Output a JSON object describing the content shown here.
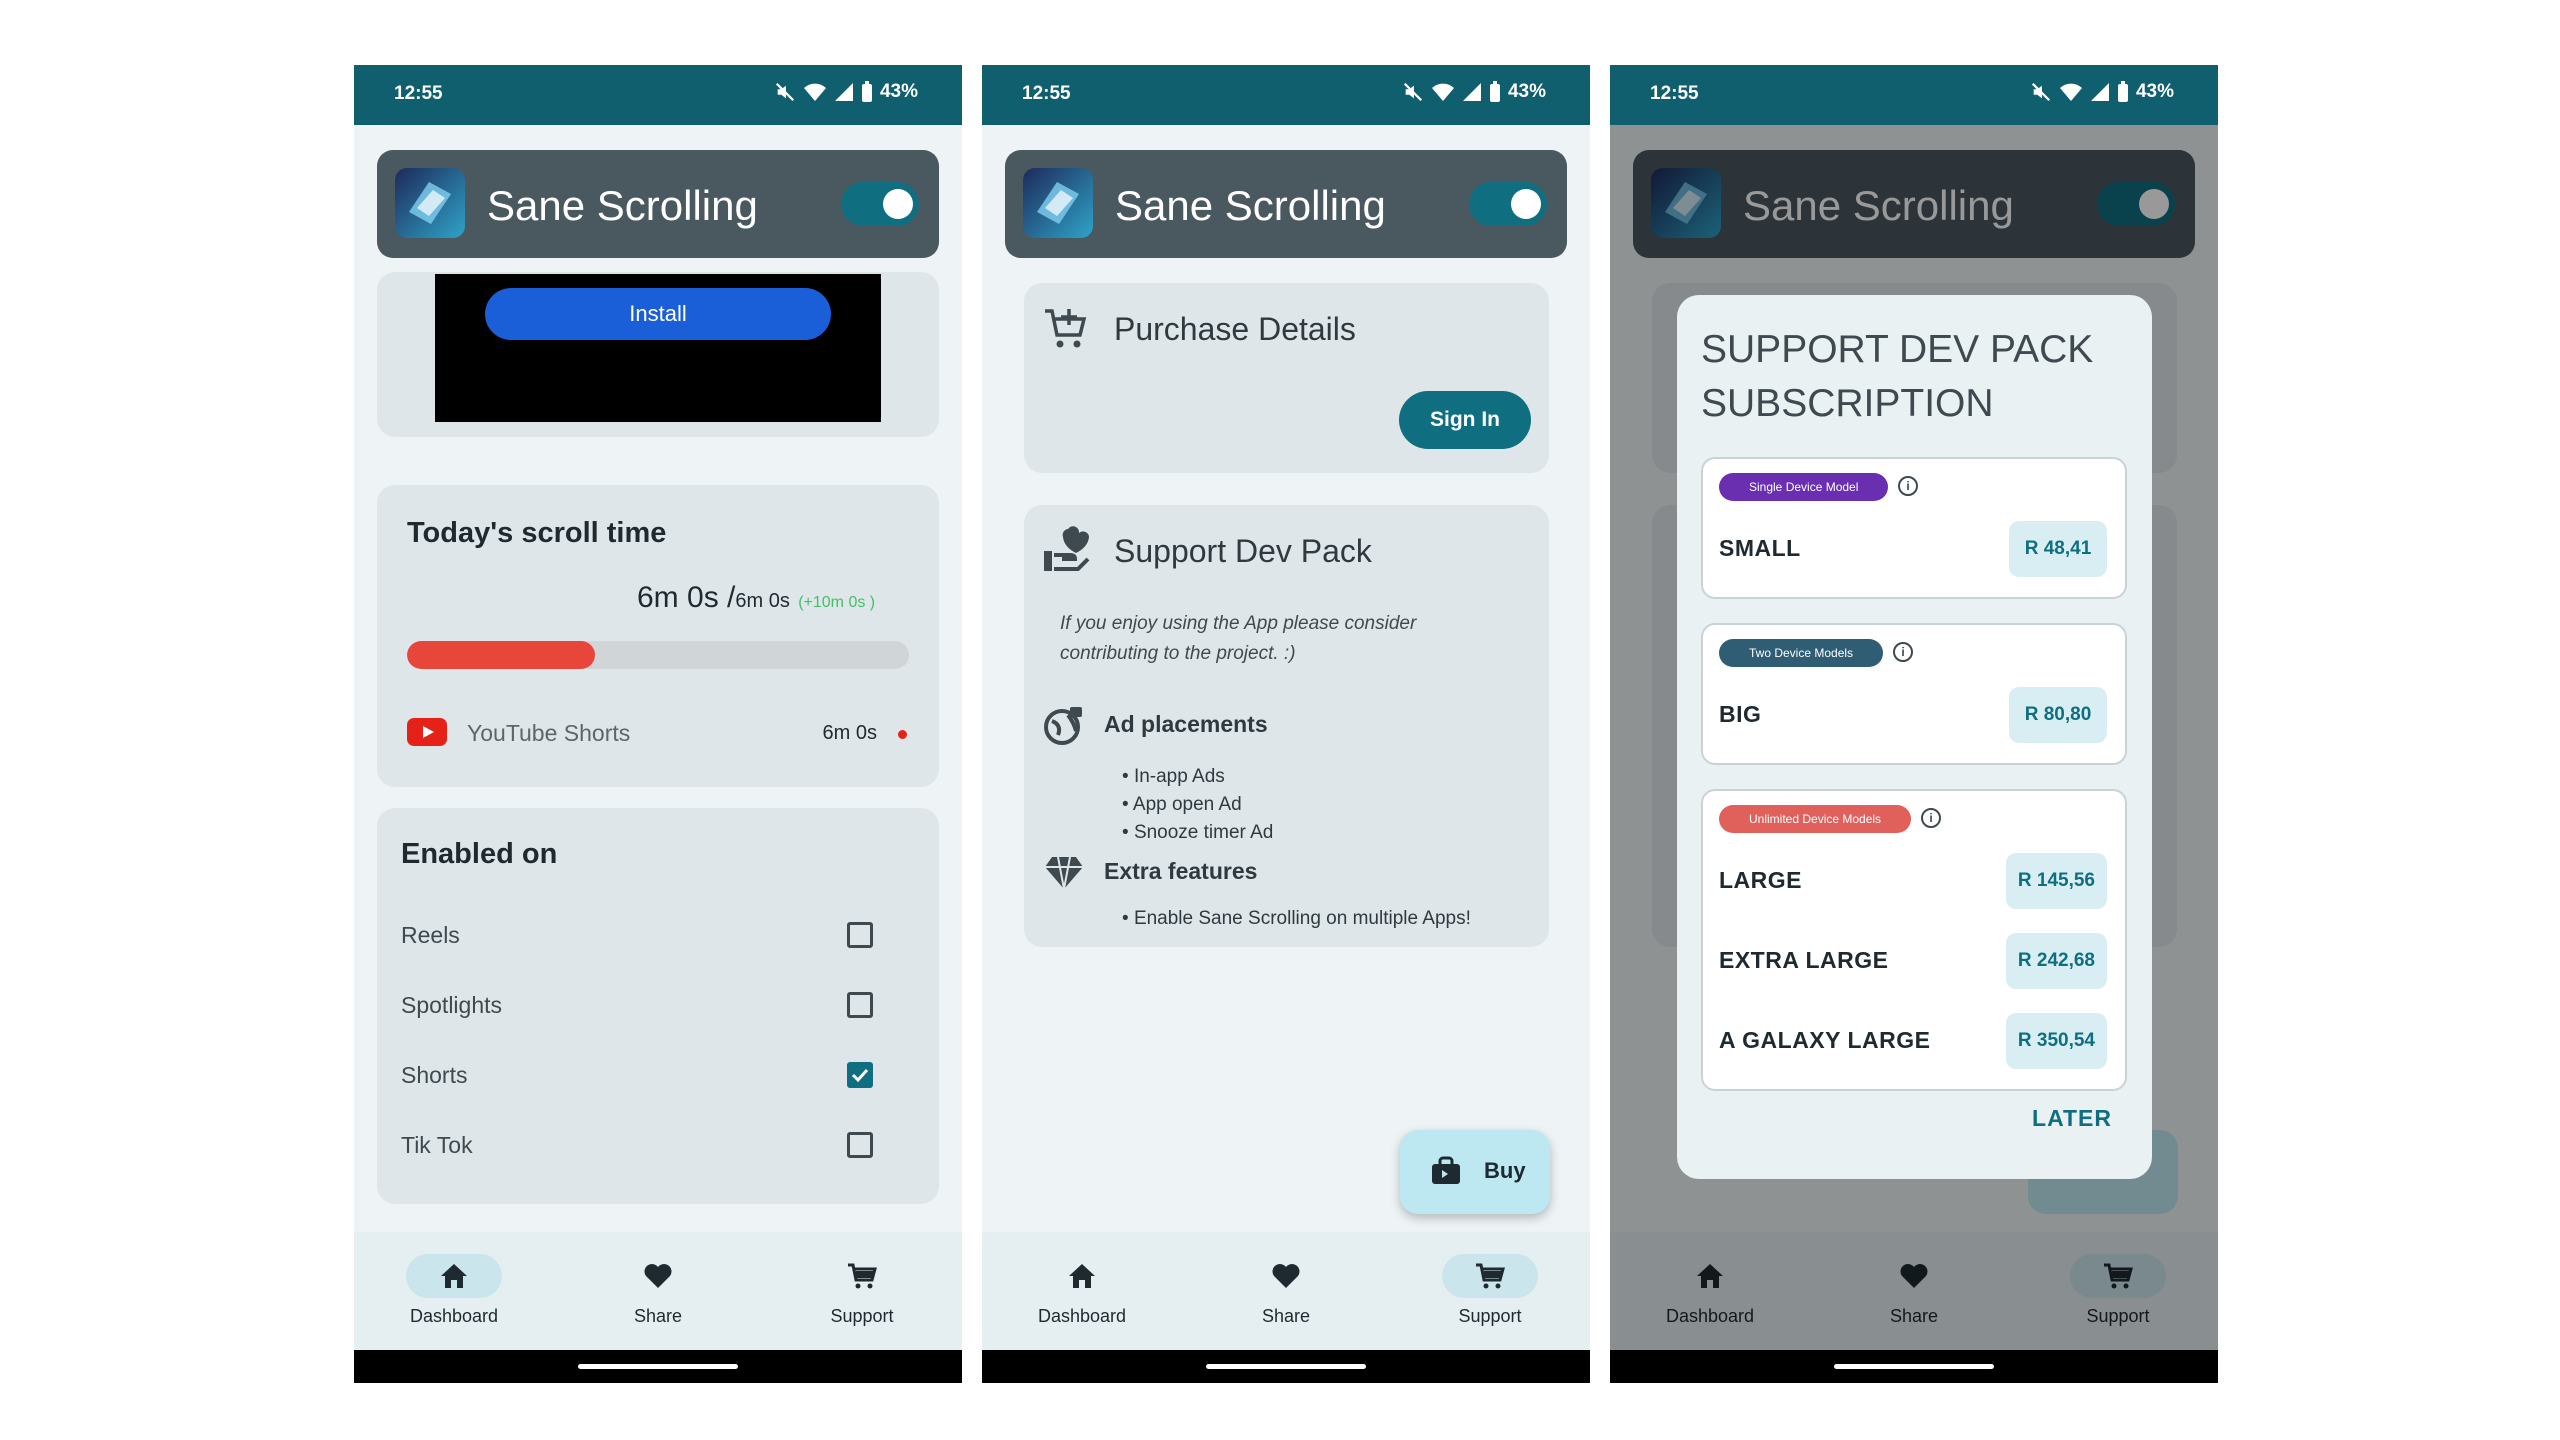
{
  "status_bar": {
    "time": "12:55",
    "battery": "43%"
  },
  "app": {
    "title": "Sane Scrolling"
  },
  "nav": {
    "dashboard": "Dashboard",
    "share": "Share",
    "support": "Support"
  },
  "screen1": {
    "ad": {
      "install_label": "Install"
    },
    "scroll_time": {
      "title": "Today's scroll time",
      "time_main": "6m 0s",
      "separator": "/",
      "limit": "6m 0s",
      "bonus": "(+10m 0s )",
      "progress_fraction": 0.375,
      "app_name": "YouTube Shorts",
      "app_time": "6m 0s"
    },
    "enabled_on": {
      "title": "Enabled on",
      "items": [
        {
          "label": "Reels",
          "checked": false
        },
        {
          "label": "Spotlights",
          "checked": false
        },
        {
          "label": "Shorts",
          "checked": true
        },
        {
          "label": "Tik Tok",
          "checked": false
        }
      ]
    }
  },
  "screen2": {
    "purchase": {
      "title": "Purchase Details",
      "signin_label": "Sign In"
    },
    "support_pack": {
      "title": "Support Dev Pack",
      "description": "If you enjoy using the App please consider contributing to the project. :)",
      "ad_title": "Ad placements",
      "ad_items": [
        "In-app Ads",
        "App open Ad",
        "Snooze timer Ad"
      ],
      "extra_title": "Extra features",
      "extra_items": [
        "Enable Sane Scrolling on multiple Apps!"
      ]
    },
    "buy_label": "Buy"
  },
  "screen3": {
    "dialog": {
      "title_line1": "SUPPORT DEV PACK",
      "title_line2": "SUBSCRIPTION",
      "groups": [
        {
          "badge": "Single Device Model",
          "badge_color": "#6a2fb0",
          "plans": [
            {
              "name": "SMALL",
              "price": "R 48,41"
            }
          ]
        },
        {
          "badge": "Two Device Models",
          "badge_color": "#2e5d74",
          "plans": [
            {
              "name": "BIG",
              "price": "R 80,80"
            }
          ]
        },
        {
          "badge": "Unlimited Device Models",
          "badge_color": "#e0605c",
          "plans": [
            {
              "name": "LARGE",
              "price": "R 145,56"
            },
            {
              "name": "EXTRA LARGE",
              "price": "R 242,68"
            },
            {
              "name": "A GALAXY LARGE",
              "price": "R 350,54"
            }
          ]
        }
      ],
      "later_label": "LATER"
    }
  },
  "colors": {
    "status_bar": "#0f5f6e",
    "accent": "#0f6f80",
    "progress": "#e8463a",
    "install_button": "#1a5ed8"
  }
}
